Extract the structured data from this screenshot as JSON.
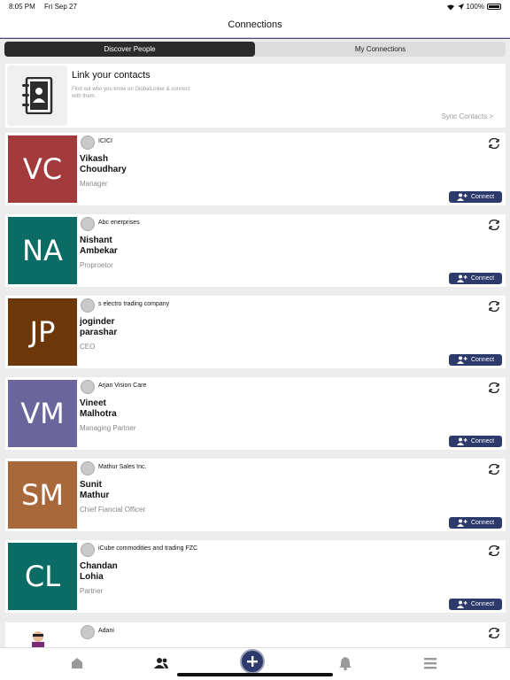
{
  "status": {
    "time": "8:05 PM",
    "date": "Fri Sep 27",
    "battery": "100%"
  },
  "header": {
    "title": "Connections"
  },
  "tabs": [
    {
      "label": "Discover People",
      "active": true
    },
    {
      "label": "My Connections",
      "active": false
    }
  ],
  "sync": {
    "title": "Link your contacts",
    "subtitle": "Find out who you know on GlobalLinker & connect with them.",
    "link": "Sync Contacts >"
  },
  "people": [
    {
      "initials": "VC",
      "first": "Vikash",
      "last": "Choudhary",
      "role": "Manager",
      "company": "ICICI",
      "color": "#a33a3c",
      "connect": "Connect"
    },
    {
      "initials": "NA",
      "first": "Nishant",
      "last": "Ambekar",
      "role": "Proproetor",
      "company": "Abc enerprises",
      "color": "#0b6b65",
      "connect": "Connect"
    },
    {
      "initials": "JP",
      "first": "joginder",
      "last": "parashar",
      "role": "CEO",
      "company": "s electro trading company",
      "color": "#6c3809",
      "connect": "Connect"
    },
    {
      "initials": "VM",
      "first": "Vineet",
      "last": "Malhotra",
      "role": "Managing Partner",
      "company": "Arjan Vision Care",
      "color": "#6b659e",
      "connect": "Connect"
    },
    {
      "initials": "SM",
      "first": "Sunit",
      "last": "Mathur",
      "role": "Chief Fiancial Officer",
      "company": "Mathur Sales Inc.",
      "color": "#a8683a",
      "connect": "Connect"
    },
    {
      "initials": "CL",
      "first": "Chandan",
      "last": "Lohia",
      "role": "Partner",
      "company": "iCube commodities and trading FZC",
      "color": "#0b6b65",
      "connect": "Connect"
    }
  ],
  "partial": {
    "company": "Adani"
  },
  "colors": {
    "accent": "#2c3a6c"
  }
}
